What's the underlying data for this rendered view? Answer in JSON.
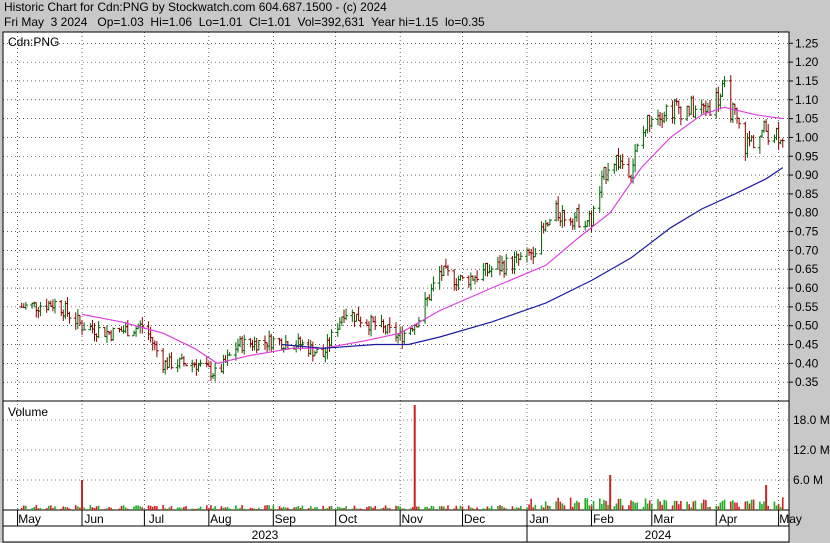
{
  "header": {
    "line1": "Historic Chart for Cdn:PNG by Stockwatch.com 604.687.1500 - (c) 2024",
    "line2": "Fri May  3 2024   Op=1.03  Hi=1.06  Lo=1.01  Cl=1.01  Vol=392,631  Year hi=1.15  lo=0.35"
  },
  "colors": {
    "up_bar": "#006400",
    "down_bar": "#8b0000",
    "ma_short": "#e040e0",
    "ma_long": "#1a1aa0",
    "vol_up": "#22aa22",
    "vol_down": "#cc2222",
    "grid": "#000000"
  },
  "chart_data": {
    "type": "line",
    "symbol_label": "Cdn:PNG",
    "price_ylim": [
      0.3,
      1.28
    ],
    "price_ticks": [
      "1.25",
      "1.20",
      "1.15",
      "1.10",
      "1.05",
      "1.00",
      "0.95",
      "0.90",
      "0.85",
      "0.80",
      "0.75",
      "0.70",
      "0.65",
      "0.60",
      "0.55",
      "0.50",
      "0.45",
      "0.40",
      "0.35"
    ],
    "volume_label": "Volume",
    "volume_ticks": [
      "18.0 M",
      "12.0 M",
      "6.0 M"
    ],
    "volume_ylim": [
      0,
      21
    ],
    "month_labels": [
      "May",
      "Jun",
      "Jul",
      "Aug",
      "Sep",
      "Oct",
      "Nov",
      "Dec",
      "Jan",
      "Feb",
      "Mar",
      "Apr",
      "May"
    ],
    "year_labels": [
      "2023",
      "2024"
    ],
    "series": [
      {
        "role": "price_close",
        "x": [
          "2023-05-03",
          "2023-05-20",
          "2023-06-01",
          "2023-06-15",
          "2023-07-01",
          "2023-07-10",
          "2023-07-25",
          "2023-08-05",
          "2023-08-15",
          "2023-09-01",
          "2023-09-15",
          "2023-09-25",
          "2023-10-05",
          "2023-10-20",
          "2023-11-01",
          "2023-11-10",
          "2023-11-20",
          "2023-12-01",
          "2023-12-15",
          "2024-01-01",
          "2024-01-15",
          "2024-02-01",
          "2024-02-10",
          "2024-02-20",
          "2024-03-01",
          "2024-03-15",
          "2024-03-25",
          "2024-04-05",
          "2024-04-15",
          "2024-04-25",
          "2024-05-03"
        ],
        "values": [
          0.55,
          0.56,
          0.5,
          0.48,
          0.5,
          0.4,
          0.4,
          0.37,
          0.45,
          0.46,
          0.45,
          0.42,
          0.54,
          0.5,
          0.47,
          0.52,
          0.64,
          0.62,
          0.65,
          0.68,
          0.8,
          0.78,
          0.95,
          0.92,
          1.07,
          1.08,
          1.07,
          1.12,
          0.98,
          1.02,
          1.01
        ]
      },
      {
        "role": "ma_short",
        "x": [
          "2023-06-01",
          "2023-06-20",
          "2023-07-10",
          "2023-07-25",
          "2023-08-05",
          "2023-08-20",
          "2023-09-10",
          "2023-09-25",
          "2023-10-15",
          "2023-11-01",
          "2023-11-20",
          "2023-12-15",
          "2024-01-10",
          "2024-01-25",
          "2024-02-10",
          "2024-02-25",
          "2024-03-10",
          "2024-03-25",
          "2024-04-05",
          "2024-04-20",
          "2024-05-03"
        ],
        "values": [
          0.53,
          0.51,
          0.48,
          0.44,
          0.4,
          0.42,
          0.44,
          0.44,
          0.46,
          0.48,
          0.54,
          0.6,
          0.66,
          0.73,
          0.8,
          0.92,
          1.0,
          1.06,
          1.08,
          1.06,
          1.05
        ]
      },
      {
        "role": "ma_long",
        "x": [
          "2023-09-05",
          "2023-09-25",
          "2023-10-20",
          "2023-11-05",
          "2023-11-20",
          "2023-12-15",
          "2024-01-10",
          "2024-02-01",
          "2024-02-20",
          "2024-03-10",
          "2024-03-25",
          "2024-04-10",
          "2024-04-25",
          "2024-05-03"
        ],
        "values": [
          0.45,
          0.44,
          0.45,
          0.45,
          0.47,
          0.51,
          0.56,
          0.62,
          0.68,
          0.76,
          0.81,
          0.85,
          0.89,
          0.92
        ]
      }
    ],
    "volume_spikes": [
      {
        "x": "2023-06-01",
        "value": 6.0
      },
      {
        "x": "2023-11-08",
        "value": 21.0
      },
      {
        "x": "2024-02-10",
        "value": 7.0
      },
      {
        "x": "2024-04-25",
        "value": 5.0
      }
    ]
  }
}
